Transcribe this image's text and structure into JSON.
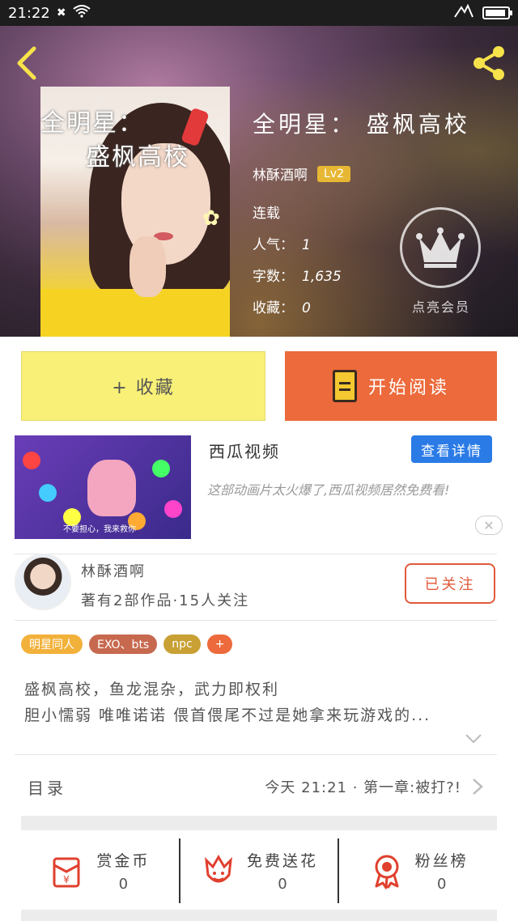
{
  "status_bar": {
    "time": "21:22",
    "notif_icon": "close-icon",
    "wifi_icon": "wifi-icon"
  },
  "header": {
    "back_icon": "back-arrow-icon",
    "share_icon": "share-icon",
    "cover_title_line1": "全明星：",
    "cover_title_line2": "盛枫高校",
    "book_title": "全明星：  盛枫高校",
    "author": "林酥酒啊",
    "level": "Lv2",
    "status": "连载",
    "popularity_label": "人气：",
    "popularity": "1",
    "words_label": "字数：",
    "words": "1,635",
    "favorites_label": "收藏：",
    "favorites": "0",
    "vip_label": "点亮会员",
    "accent_color": "#f6e24a"
  },
  "actions": {
    "collect_label": "+ 收藏",
    "read_label": "开始阅读"
  },
  "ad": {
    "title": "西瓜视频",
    "detail_label": "查看详情",
    "description": "这部动画片太火爆了,西瓜视频居然免费看!",
    "thumb_caption": "不要担心，我来救你",
    "close_icon": "close-icon"
  },
  "author_card": {
    "name": "林酥酒啊",
    "meta": "著有2部作品·15人关注",
    "follow_label": "已关注"
  },
  "tags": [
    {
      "label": "明星同人",
      "color": "#f2b13a"
    },
    {
      "label": "EXO、bts",
      "color": "#c7694f"
    },
    {
      "label": "npc",
      "color": "#c8a034"
    },
    {
      "label": "+",
      "color": "#ec6a3b"
    }
  ],
  "summary": {
    "line1": "盛枫高校，鱼龙混杂，武力即权利",
    "line2": "胆小懦弱 唯唯诺诺 偎首偎尾不过是她拿来玩游戏的..."
  },
  "toc": {
    "label": "目录",
    "latest": "今天 21:21 · 第一章:被打?!"
  },
  "bottom_actions": [
    {
      "label": "赏金币",
      "count": "0",
      "icon": "red-envelope-icon"
    },
    {
      "label": "免费送花",
      "count": "0",
      "icon": "flower-icon"
    },
    {
      "label": "粉丝榜",
      "count": "0",
      "icon": "medal-icon"
    }
  ]
}
